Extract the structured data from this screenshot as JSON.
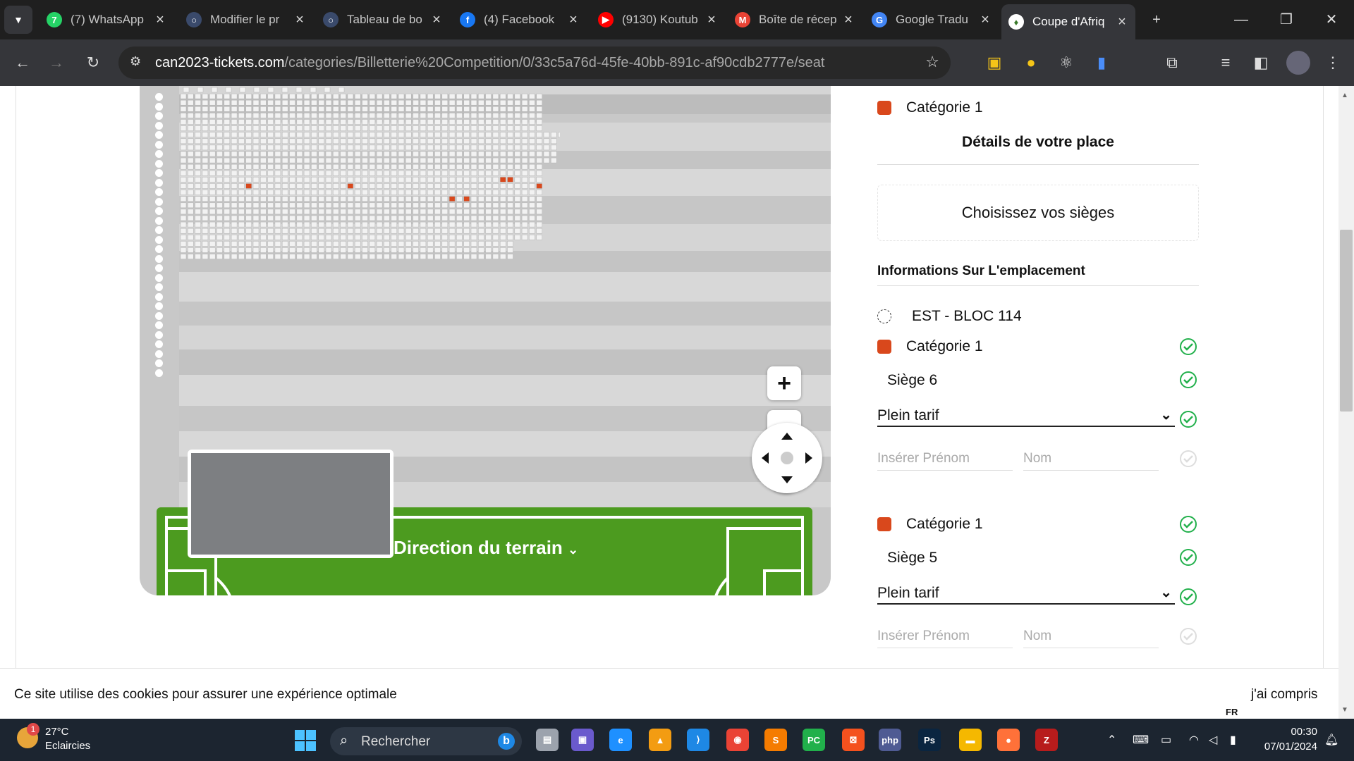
{
  "browser": {
    "tabs": [
      {
        "title": "(7) WhatsApp",
        "color": "#25d366",
        "glyph": "7"
      },
      {
        "title": "Modifier le pr",
        "color": "#3a4a6b",
        "glyph": "○"
      },
      {
        "title": "Tableau de bo",
        "color": "#3a4a6b",
        "glyph": "○"
      },
      {
        "title": "(4) Facebook",
        "color": "#1877f2",
        "glyph": "f"
      },
      {
        "title": "(9130) Koutub",
        "color": "#ff0000",
        "glyph": "▶"
      },
      {
        "title": "Boîte de récep",
        "color": "#ea4335",
        "glyph": "M"
      },
      {
        "title": "Google Tradu",
        "color": "#4285f4",
        "glyph": "G"
      },
      {
        "title": "Coupe d'Afriq",
        "color": "#ffffff",
        "glyph": "♦"
      }
    ],
    "url_host": "can2023-tickets.com",
    "url_path": "/categories/Billetterie%20Competition/0/33c5a76d-45fe-40bb-891c-af90cdb2777e/seat"
  },
  "seatmap": {
    "zoom_in": "+",
    "zoom_out": "−",
    "pitch_label": "Direction du terrain",
    "selected_seat_color": "#d9481c"
  },
  "sidebar": {
    "top_category": "Catégorie 1",
    "details_heading": "Détails de votre place",
    "choose_seats": "Choisissez vos sièges",
    "info_heading": "Informations Sur L'emplacement",
    "location": "EST - BLOC 114",
    "tickets": [
      {
        "category": "Catégorie 1",
        "seat": "Siège 6",
        "tariff": "Plein tarif",
        "firstname_placeholder": "Insérer Prénom",
        "lastname_placeholder": "Nom"
      },
      {
        "category": "Catégorie 1",
        "seat": "Siège 5",
        "tariff": "Plein tarif",
        "firstname_placeholder": "Insérer Prénom",
        "lastname_placeholder": "Nom"
      }
    ]
  },
  "cookie": {
    "message": "Ce site utilise des cookies pour assurer une expérience optimale",
    "accept": "j'ai compris"
  },
  "taskbar": {
    "weather_temp": "27°C",
    "weather_desc": "Eclaircies",
    "weather_badge": "1",
    "search_placeholder": "Rechercher",
    "lang": "FR",
    "time": "00:30",
    "date": "07/01/2024"
  }
}
